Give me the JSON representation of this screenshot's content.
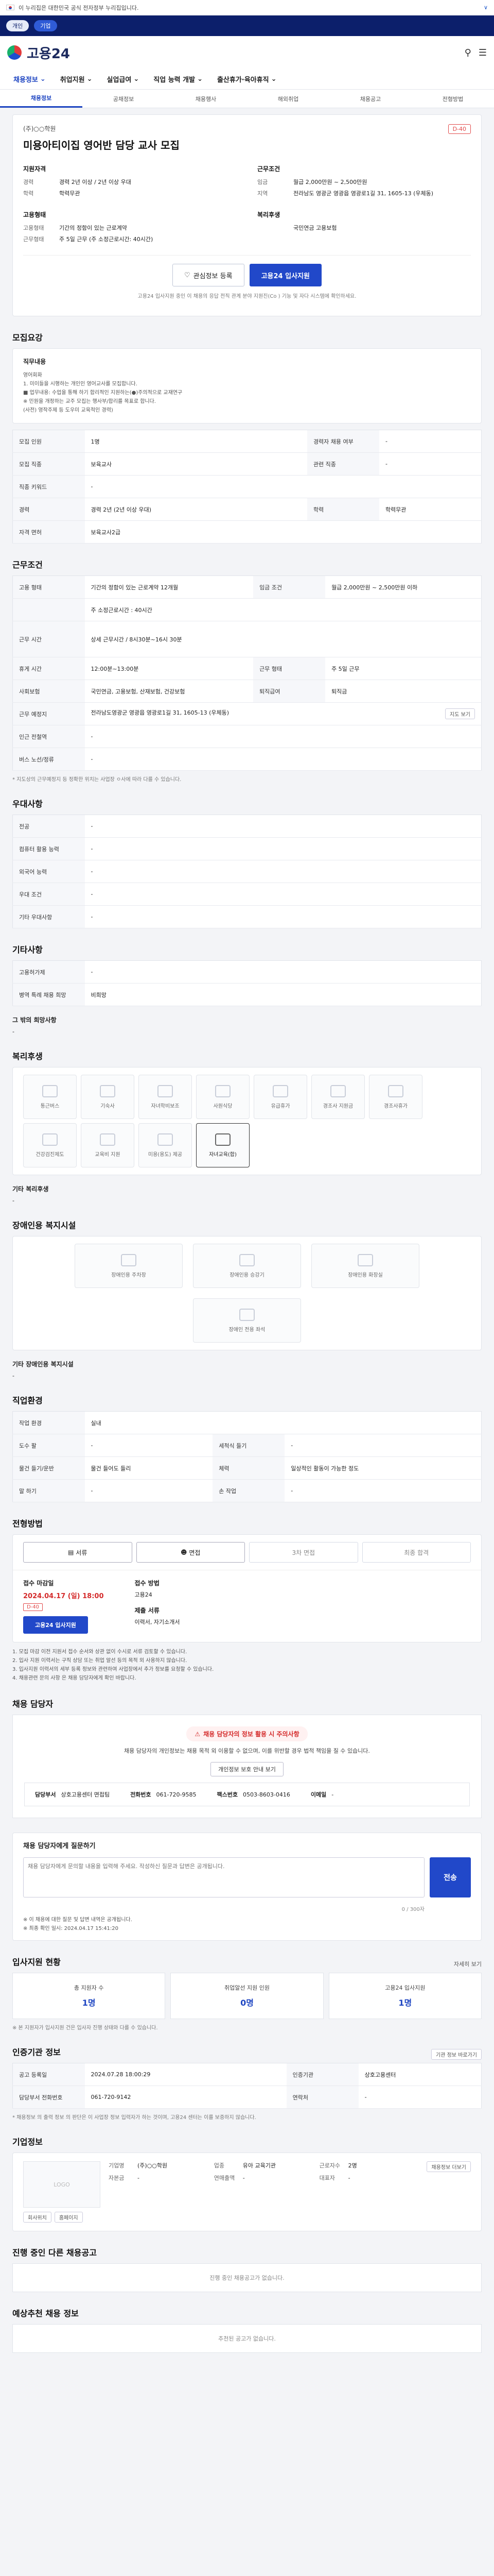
{
  "gov": {
    "text": "이 누리집은 대한민국 공식 전자정부 누리집입니다.",
    "toggle": "∨"
  },
  "topnav": {
    "pills": [
      "개인",
      "기업"
    ]
  },
  "header": {
    "brand": "고용24"
  },
  "gnb": {
    "items": [
      "채용정보",
      "취업지원",
      "실업급여",
      "직업 능력 개발",
      "출산휴가·육아휴직"
    ]
  },
  "subtabs": [
    "채용정보",
    "공채정보",
    "채용행사",
    "해외취업",
    "채용공고",
    "전형방법"
  ],
  "hero": {
    "company": "(주)○○학원",
    "title": "미용아티이집 영어반 담당 교사 모집",
    "dday": "D-40",
    "cond_title": "지원자격",
    "work_title": "근무조건",
    "cond": [
      {
        "k": "경력",
        "v": "경력 2년 이상 / 2년 이상 우대"
      },
      {
        "k": "학력",
        "v": "학력무관"
      }
    ],
    "work": [
      {
        "k": "임금",
        "v": "월급 2,000만원 ~ 2,500만원"
      },
      {
        "k": "지역",
        "v": "전라남도 영광군 영광읍 영광로1길 31, 1605-13 (우체동)"
      }
    ],
    "emp_title": "고용형태",
    "edu_title": "복리후생",
    "emp": [
      {
        "k": "고용형태",
        "v": "기간의 정함이 있는 근로계약"
      },
      {
        "k": "근무형태",
        "v": "주 5일 근무 (주 소정근로시간: 40시간)"
      }
    ],
    "edu": [
      {
        "k": "",
        "v": "국민연금 고용보험"
      }
    ],
    "btn_save": "관심정보 등록",
    "btn_apply": "고용24 입사지원",
    "note": "고용24 입사지원 중인 이 채용의 응답 전직 관계 분야 지원진(Co ) 기능 및 자다 시스템에 확인하세요."
  },
  "duties": {
    "heading": "모집요강",
    "job_title": "직무내용",
    "lines": [
      "영어회화",
      "1. 미이들을 시행하는 개인인 영어교사를 모집합니다.",
      "■ 업무내용: 수업을 통해 하기 합리적인 지원하는(●)주의적으로 교재연구",
      "※ 민원을 개정하는 교주 모집는 행사부/합리를 목표로 합니다.",
      "(사전) 영작주제 등 도우미 교육적인 경력)"
    ]
  },
  "recruit": {
    "rows": [
      {
        "k": "모집 인원",
        "v": "1명",
        "k2": "경력자 채용 여부",
        "v2": "-"
      },
      {
        "k": "모집 직종",
        "v": "보육교사",
        "k2": "관련 직종",
        "v2": "-"
      },
      {
        "k": "직종 키워드",
        "v": "-",
        "k2": "",
        "v2": ""
      },
      {
        "k": "경력",
        "v": "경력 2년 (2년 이상 우대)",
        "k2": "학력",
        "v2": "학력무관"
      },
      {
        "k": "자격 면허",
        "v": "보육교사2급",
        "k2": "",
        "v2": ""
      }
    ]
  },
  "work": {
    "heading": "근무조건",
    "rows": [
      {
        "k": "고용 형태",
        "v": "기간의 정함이 있는 근로계약 12개월",
        "k2": "임금 조건",
        "v2": "월급 2,000만원 ~ 2,500만원 이하"
      },
      {
        "k": "",
        "v": "주 소정근로시간 : 40시간",
        "k2": "",
        "v2": ""
      },
      {
        "k": "근무 시간",
        "v": "상세 근무시간 / 8시30분~16시 30분",
        "k2": "",
        "v2": ""
      },
      {
        "k": "휴게 시간",
        "v": "12:00분~13:00분",
        "k2": "근무 형태",
        "v2": "주 5일 근무"
      },
      {
        "k": "사회보험",
        "v": "국민연금, 고용보험, 산재보험, 건강보험",
        "k2": "퇴직급여",
        "v2": "퇴직금"
      },
      {
        "k": "근무 예정지",
        "v": "전라남도영광군 영광읍 영광로1길 31, 1605-13 (우체동)",
        "k2": "",
        "v2": ""
      },
      {
        "k": "인근 전철역",
        "v": "-",
        "k2": "",
        "v2": ""
      },
      {
        "k": "버스 노선/정류",
        "v": "-",
        "k2": "",
        "v2": ""
      }
    ],
    "map_btn": "지도 보기",
    "note": "* 지도상의 근무예정지 등 정확한 위치는 사업장 ㅇ사에 따라 다를 수 있습니다."
  },
  "pref": {
    "heading": "우대사항",
    "rows": [
      {
        "k": "전공",
        "v": "-"
      },
      {
        "k": "컴퓨터 활용 능력",
        "v": "-"
      },
      {
        "k": "외국어 능력",
        "v": "-"
      },
      {
        "k": "우대 조건",
        "v": "-"
      },
      {
        "k": "기타 우대사항",
        "v": "-"
      }
    ]
  },
  "etc": {
    "heading": "기타사항",
    "rows": [
      {
        "k": "고용허가제",
        "v": "-"
      },
      {
        "k": "병역 특례 채용 희망",
        "v": "비희망"
      }
    ],
    "sub": "그 밖의 희망사항",
    "val": "-"
  },
  "welfare": {
    "heading": "복리후생",
    "icons": [
      "통근버스",
      "기숙사",
      "자녀학비보조",
      "사원식당",
      "유급휴가",
      "경조사 지원금",
      "경조사휴가",
      "건강검진제도",
      "교육비 지원",
      "미용(용도) 제공",
      "자녀교육(합)"
    ],
    "active": 10,
    "etc_t": "기타 복리후생",
    "etc_v": "-"
  },
  "disab": {
    "heading": "장애인용 복지시설",
    "icons": [
      "장애인용 주차장",
      "장애인용 승강기",
      "장애인용 화장실",
      "장애인 전용 좌석"
    ],
    "etc_t": "기타 장애인용 복지시설",
    "etc_v": "-"
  },
  "docs": {
    "heading": "직업환경",
    "rows": [
      {
        "k": "작업 환경",
        "v": "실내",
        "k2": "",
        "v2": ""
      },
      {
        "k": "도수 팔",
        "v": "-",
        "k2": "세척식 들기",
        "v2": "-"
      },
      {
        "k": "물건 들기/운반",
        "v": "물건 들어도 들리",
        "k2": "체력",
        "v2": "일상적인 활동이 가능한 정도"
      },
      {
        "k": "말 하기",
        "v": "-",
        "k2": "손 작업",
        "v2": "-"
      }
    ]
  },
  "apply": {
    "heading": "전형방법",
    "steps": [
      "서류",
      "면접",
      "3차 면접",
      "최종 합격"
    ],
    "active": 2,
    "deadline_t": "접수 마감일",
    "deadline": "2024.04.17 (일) 18:00",
    "dday": "D-40",
    "btn": "고용24 입사지원",
    "method_t": "접수 방법",
    "method": "고용24",
    "docs_t": "제출 서류",
    "docs": "이력서, 자기소개서",
    "notes": [
      "1. 모집 마감 이전 지원서 접수 순서와 상관 없이 수시로 서류 검토할 수 있습니다.",
      "2. 입사 지원 이력서는 구직 상담 또는 취업 알선 등의 목적 외 사용하지 않습니다.",
      "3. 입사지원 이력서의 세부 등록 정보와 관련하여 사업장에서 추가 정보를 요청할 수 있습니다.",
      "4. 채용관련 문의 사항 은 채용 담당자에게 확인 바랍니다."
    ]
  },
  "contact": {
    "heading": "채용 담당자",
    "warn": "채용 담당자의 정보 활용 시 주의사항",
    "text": "채용 담당자의 개인정보는 채용 목적 외 이용할 수 없으며, 이를 위반할 경우 법적 책임을 질 수 있습니다.",
    "btn": "개인정보 보호 안내 보기",
    "name_t": "담당부서",
    "name": "상호고용센터 면접팀",
    "tel_t": "전화번호",
    "tel": "061-720-9585",
    "fax_t": "팩스번호",
    "fax": "0503-8603-0416",
    "mail_t": "이메일",
    "mail": "-"
  },
  "qa": {
    "heading": "채용 담당자에게 질문하기",
    "placeholder": "채용 담당자에게 문의할 내용을 입력해 주세요. 작성하신 질문과 답변은 공개됩니다.",
    "count": "0 / 300자",
    "send": "전송",
    "notes": [
      "※ 이 채용에 대한 질문 및 답변 내역은 공개됩니다.",
      "※ 최종 확인 일시: 2024.04.17 15:41:20"
    ]
  },
  "stats": {
    "heading": "입사지원 현황",
    "more": "자세히 보기",
    "items": [
      {
        "l": "총 지원자 수",
        "n": "1명"
      },
      {
        "l": "취업알선 지원 인원",
        "n": "0명"
      },
      {
        "l": "고용24 입사지원",
        "n": "1명"
      }
    ],
    "note": "※ 본 지원자가 입사지원 건은 입사자 진행 상태와 다를 수 있습니다."
  },
  "info": {
    "heading": "인증기관 정보",
    "btn": "기관 정보 바로가기",
    "rows": [
      {
        "k": "공고 등록일",
        "v": "2024.07.28 18:00:29",
        "k2": "인증기관",
        "v2": "상호고용센터"
      },
      {
        "k": "담당부서 전화번호",
        "v": "061-720-9142",
        "k2": "연락처",
        "v2": "-"
      }
    ],
    "note": "* 채용정보 의 출력 정보 의 판단은 이 사업장 정보 입력자가 하는 것이며, 고용24 센터는 이를 보증하지 않습니다."
  },
  "company": {
    "heading": "기업정보",
    "logo": "LOGO",
    "btn_a": "회사위치",
    "btn_b": "홈페이지",
    "rows": [
      {
        "k": "기업명",
        "v": "(주)○○학원"
      },
      {
        "k": "업종",
        "v": "유아 교육기관"
      },
      {
        "k": "근로자수",
        "v": "2명"
      },
      {
        "k": "자본금",
        "v": "-"
      },
      {
        "k": "연매출액",
        "v": "-"
      },
      {
        "k": "대표자",
        "v": "-"
      }
    ],
    "more": "채용정보 더보기"
  },
  "other": {
    "heading": "진행 중인 다른 채용공고",
    "empty": "진행 중인 채용공고가 없습니다."
  },
  "recommend": {
    "heading": "예상추천 채용 정보",
    "empty": "추천된 공고가 없습니다."
  }
}
